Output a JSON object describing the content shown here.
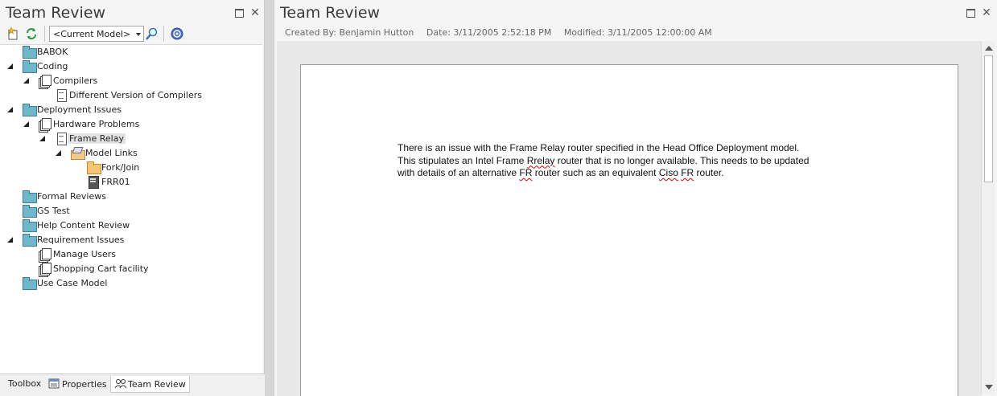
{
  "left_panel": {
    "title": "Team Review",
    "model_select": {
      "value": "<Current Model>"
    },
    "tree": [
      {
        "label": "BABOK",
        "icon": "package-folder-icon",
        "expander": "closed"
      },
      {
        "label": "Coding",
        "icon": "package-folder-icon",
        "expander": "open"
      },
      {
        "label": "Compilers",
        "icon": "stack-icon",
        "expander": "open"
      },
      {
        "label": "Different Version of Compilers",
        "icon": "document-icon",
        "expander": "none"
      },
      {
        "label": "Deployment Issues",
        "icon": "package-folder-icon",
        "expander": "open"
      },
      {
        "label": "Hardware Problems",
        "icon": "stack-icon",
        "expander": "open"
      },
      {
        "label": "Frame Relay",
        "icon": "document-icon",
        "expander": "open",
        "selected": true
      },
      {
        "label": "Model Links",
        "icon": "open-package-icon",
        "expander": "open"
      },
      {
        "label": "Fork/Join",
        "icon": "folder-icon",
        "expander": "none"
      },
      {
        "label": "FRR01",
        "icon": "artifact-icon",
        "expander": "none"
      },
      {
        "label": "Formal Reviews",
        "icon": "package-folder-icon",
        "expander": "none"
      },
      {
        "label": "GS Test",
        "icon": "package-folder-icon",
        "expander": "none"
      },
      {
        "label": "Help Content Review",
        "icon": "package-folder-icon",
        "expander": "closed"
      },
      {
        "label": "Requirement Issues",
        "icon": "package-folder-icon",
        "expander": "open"
      },
      {
        "label": "Manage Users",
        "icon": "stack-icon",
        "expander": "closed"
      },
      {
        "label": "Shopping Cart facility",
        "icon": "stack-icon",
        "expander": "closed"
      },
      {
        "label": "Use Case Model",
        "icon": "package-folder-icon",
        "expander": "none"
      }
    ],
    "bottom_tabs": {
      "toolbox": "Toolbox",
      "properties": "Properties",
      "team_review": "Team Review"
    }
  },
  "right_panel": {
    "title": "Team Review",
    "meta": {
      "created_by": "Created By: Benjamin Hutton",
      "date": "Date: 3/11/2005 2:52:18 PM",
      "modified": "Modified: 3/11/2005 12:00:00 AM"
    },
    "document": {
      "line1": "There is an issue with the Frame Relay router specified in the Head Office Deployment model.",
      "line2_a": "This stipulates an Intel Frame ",
      "line2_b": "Rrelay",
      "line2_c": " router that is no longer available.  This needs to be updated",
      "line3_a": "with details of an alternative ",
      "line3_b": "FR",
      "line3_c": " router such as an equivalent ",
      "line3_d": "Ciso",
      "line3_e": " ",
      "line3_f": "FR",
      "line3_g": " router."
    }
  },
  "colors": {
    "package_folder": "#6fb7cc",
    "folder": "#f6c576",
    "panel_bg": "#f5f5f5",
    "spell_error": "#dd0000"
  }
}
